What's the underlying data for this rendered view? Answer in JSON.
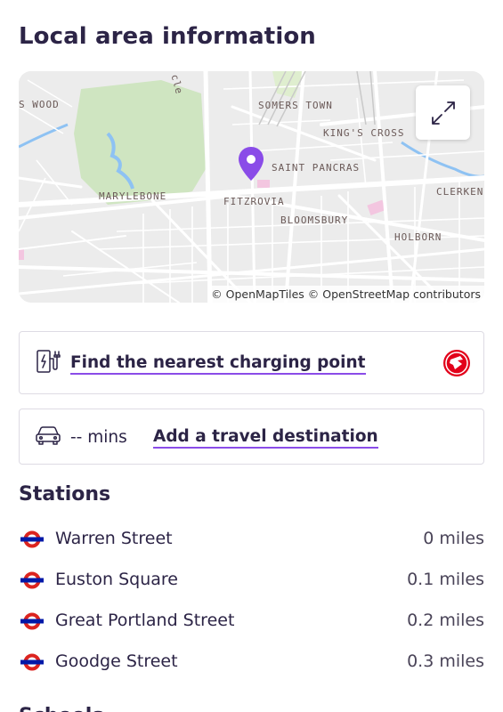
{
  "page": {
    "title": "Local area information"
  },
  "map": {
    "labels": {
      "wood": "S WOOD",
      "somers_town": "SOMERS TOWN",
      "kings_cross": "KING'S CROSS",
      "saint_pancras": "SAINT PANCRAS",
      "marylebone": "MARYLEBONE",
      "fitzrovia": "FITZROVIA",
      "clerken": "CLERKEN",
      "bloomsbury": "BLOOMSBURY",
      "holborn": "HOLBORN",
      "cle": "cle"
    },
    "attribution": "© OpenMapTiles © OpenStreetMap contributors",
    "expand_icon": "expand-arrows-icon",
    "pin_color": "#8a4ce8"
  },
  "charging": {
    "label": "Find the nearest charging point",
    "icon": "ev-charger-icon",
    "brand_logo": "vauxhall-griffin-logo",
    "brand_color": "#e2001a"
  },
  "travel": {
    "mins": "-- mins",
    "label": "Add a travel destination",
    "icon": "car-icon"
  },
  "stations": {
    "title": "Stations",
    "items": [
      {
        "name": "Warren Street",
        "distance": "0 miles"
      },
      {
        "name": "Euston Square",
        "distance": "0.1 miles"
      },
      {
        "name": "Great Portland Street",
        "distance": "0.2 miles"
      },
      {
        "name": "Goodge Street",
        "distance": "0.3 miles"
      }
    ]
  },
  "next_section": {
    "title": "Schools"
  },
  "colors": {
    "text": "#2c2446",
    "accent": "#8a4ce8",
    "underground_red": "#dc241f",
    "underground_blue": "#0019a8"
  }
}
